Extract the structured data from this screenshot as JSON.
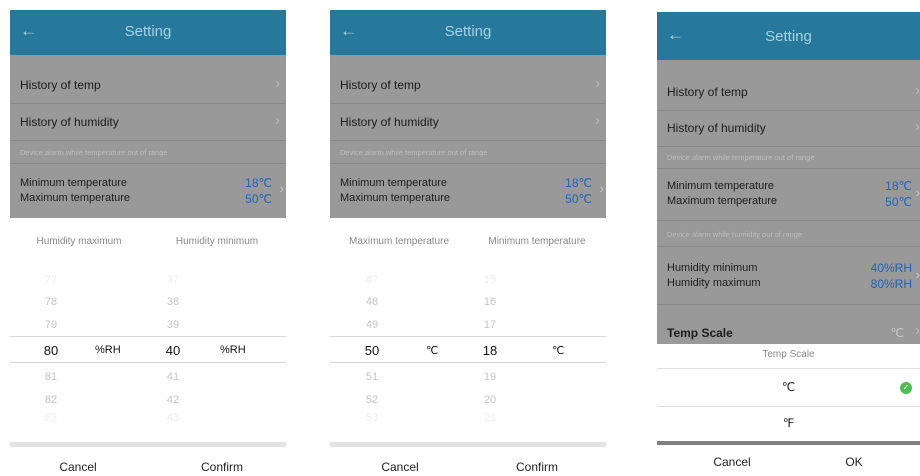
{
  "app": {
    "back_icon": "arrow-left-icon",
    "title": "Setting",
    "accent": "#27799b"
  },
  "menu": {
    "history_temp": "History of temp",
    "history_humidity": "History of humidity",
    "temp_alarm_note": "Device alarm while temperature out of range",
    "min_temp_label": "Minimum temperature",
    "max_temp_label": "Maximum temperature",
    "min_temp_value": "18℃",
    "max_temp_value": "50℃",
    "humidity_alarm_note": "Device alarm while humidity out of range",
    "humidity_min_label": "Humidity minimum",
    "humidity_max_label": "Humidity maximum",
    "humidity_min_value": "40%RH",
    "humidity_max_value": "80%RH",
    "temp_scale_label": "Temp Scale",
    "temp_scale_value": "℃"
  },
  "humidity_picker": {
    "header_left": "Humidity maximum",
    "header_right": "Humidity minimum",
    "left_column": [
      "77",
      "78",
      "79",
      "80",
      "81",
      "82",
      "83"
    ],
    "right_column": [
      "37",
      "38",
      "39",
      "40",
      "41",
      "42",
      "43"
    ],
    "unit": "%RH",
    "cancel": "Cancel",
    "confirm": "Confirm"
  },
  "temp_picker": {
    "header_left": "Maximum temperature",
    "header_right": "Minimum temperature",
    "left_column": [
      "47",
      "48",
      "49",
      "50",
      "51",
      "52",
      "53"
    ],
    "right_column": [
      "15",
      "16",
      "17",
      "18",
      "19",
      "20",
      "21"
    ],
    "unit": "℃",
    "cancel": "Cancel",
    "confirm": "Confirm"
  },
  "scale_dialog": {
    "title": "Temp Scale",
    "options": [
      "℃",
      "℉"
    ],
    "selected_icon": "check-circle-icon",
    "selected_color": "#4cbf54",
    "cancel": "Cancel",
    "ok": "OK"
  }
}
